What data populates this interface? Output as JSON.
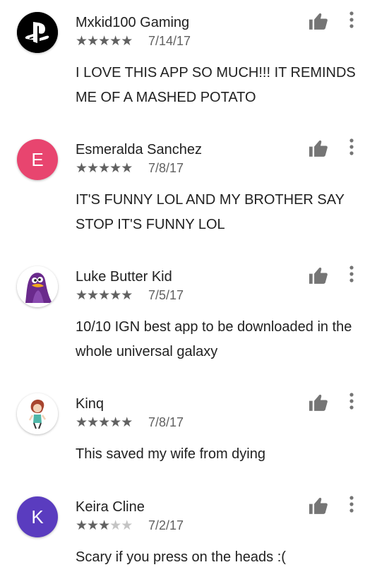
{
  "reviews": [
    {
      "name": "Mxkid100 Gaming",
      "date": "7/14/17",
      "rating": 5,
      "text": "I LOVE THIS APP SO MUCH!!! IT REMINDS ME OF A MASHED POTATO",
      "avatar_icon": "playstation-logo-icon",
      "avatar_color": "#000000"
    },
    {
      "name": "Esmeralda Sanchez",
      "date": "7/8/17",
      "rating": 5,
      "text": "IT'S FUNNY LOL AND MY BROTHER SAY STOP IT'S FUNNY LOL",
      "avatar_letter": "E",
      "avatar_color": "#e8456f"
    },
    {
      "name": "Luke Butter Kid",
      "date": "7/5/17",
      "rating": 5,
      "text": "10/10 IGN best app to be downloaded in the whole universal galaxy",
      "avatar_icon": "purple-penguin-icon",
      "avatar_color": "#ffffff"
    },
    {
      "name": "Kinq",
      "date": "7/8/17",
      "rating": 5,
      "text": "This saved my wife from dying",
      "avatar_icon": "cartoon-character-icon",
      "avatar_color": "#ffffff"
    },
    {
      "name": "Keira Cline",
      "date": "7/2/17",
      "rating": 3,
      "text": "Scary if you press on the heads :(",
      "avatar_letter": "K",
      "avatar_color": "#5a3cbf"
    }
  ],
  "icons": {
    "helpful": "thumbs-up-icon",
    "menu": "more-vert-icon"
  },
  "colors": {
    "text": "#212121",
    "secondary": "#616161",
    "icon": "#757575",
    "star_empty": "#c4c4c4"
  }
}
